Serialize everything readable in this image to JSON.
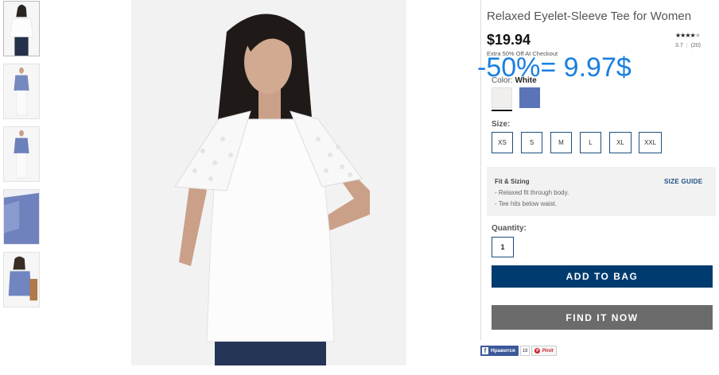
{
  "product": {
    "title": "Relaxed Eyelet-Sleeve Tee for Women",
    "price": "$19.94",
    "promo": "Extra 50% Off At Checkout",
    "rating_stars": 4,
    "rating_max": 5,
    "rating_value": "3.7",
    "review_count": "(20)"
  },
  "annotation": {
    "discount_text": "-50%= 9.97$",
    "color": "#1a7fe0"
  },
  "color": {
    "label": "Color:",
    "selected": "White",
    "swatches": [
      {
        "name": "White",
        "hex": "#f1eeee",
        "selected": true
      },
      {
        "name": "Blue",
        "hex": "#5b74b8",
        "selected": false
      }
    ]
  },
  "size": {
    "label": "Size:",
    "options": [
      "XS",
      "S",
      "M",
      "L",
      "XL",
      "XXL"
    ]
  },
  "fit": {
    "title": "Fit & Sizing",
    "guide_link": "SIZE GUIDE",
    "items": [
      "- Relaxed fit through body.",
      "- Tee hits below waist."
    ]
  },
  "quantity": {
    "label": "Quantity:",
    "value": "1"
  },
  "buttons": {
    "add_to_bag": "ADD TO BAG",
    "find_it_now": "FIND IT NOW"
  },
  "social": {
    "facebook_label": "Нравится",
    "facebook_count": "18",
    "pinterest_label": "Pinit"
  },
  "thumbnails": [
    {
      "name": "front-view-white"
    },
    {
      "name": "full-body-white"
    },
    {
      "name": "full-body-blue"
    },
    {
      "name": "sleeve-detail-blue"
    },
    {
      "name": "blue-with-bag"
    }
  ],
  "colors": {
    "primary_blue": "#003b6f",
    "find_gray": "#6b6b6b",
    "size_border": "#1d4f7d"
  }
}
